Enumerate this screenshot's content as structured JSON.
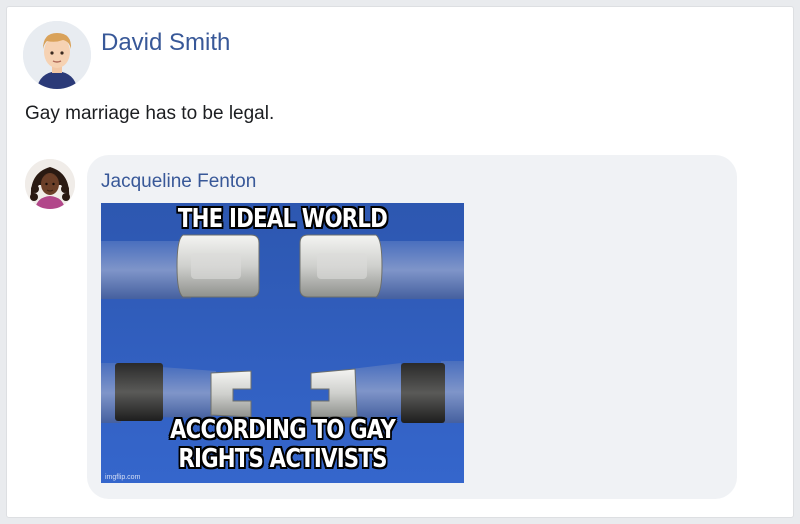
{
  "post": {
    "author": "David Smith",
    "text": "Gay marriage has to be legal."
  },
  "comment": {
    "author": "Jacqueline Fenton",
    "meme": {
      "top_text": "THE IDEAL WORLD",
      "bottom_text_line1": "ACCORDING TO GAY",
      "bottom_text_line2": "RIGHTS ACTIVISTS",
      "watermark": "imgflip.com"
    }
  },
  "colors": {
    "link": "#385898",
    "bubble": "#f0f2f5",
    "meme_bg": "#2f5fc0"
  }
}
